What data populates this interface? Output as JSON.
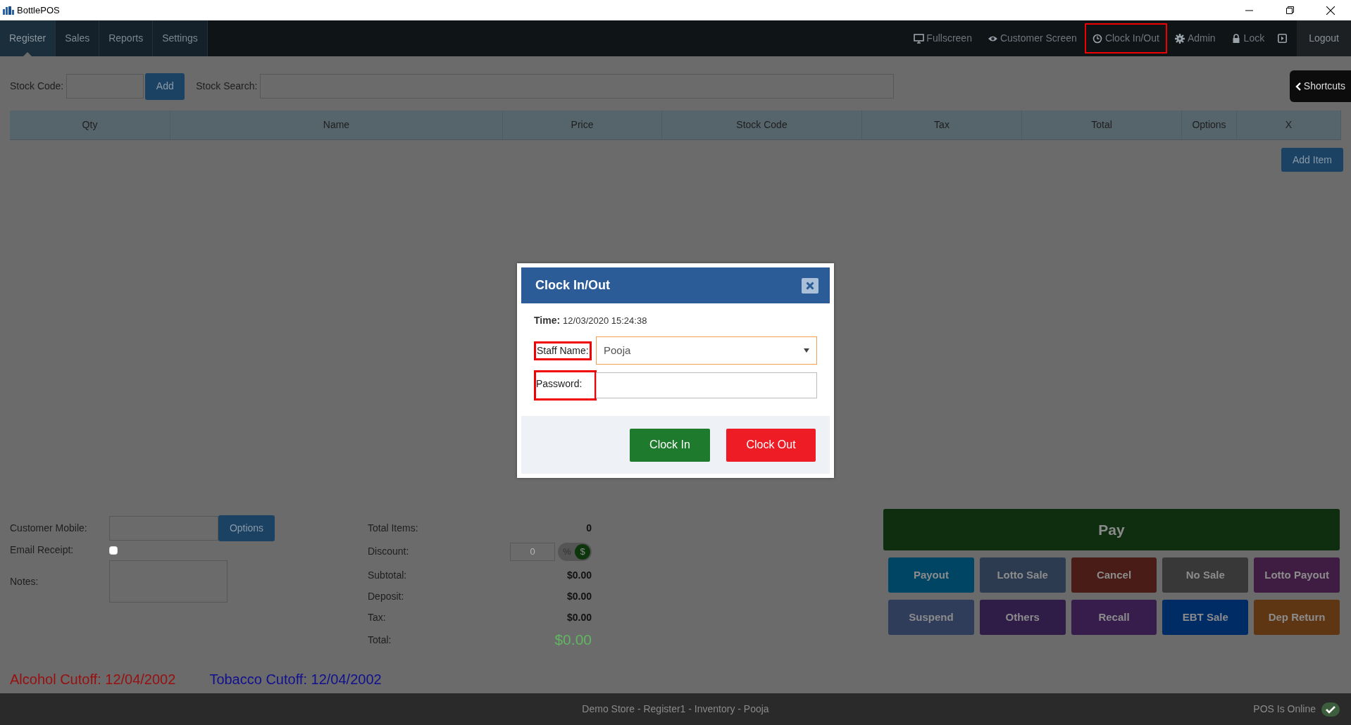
{
  "app": {
    "title": "BottlePOS"
  },
  "nav": {
    "tabs": [
      {
        "label": "Register",
        "selected": true
      },
      {
        "label": "Sales",
        "selected": false
      },
      {
        "label": "Reports",
        "selected": false
      },
      {
        "label": "Settings",
        "selected": false
      }
    ],
    "actions": [
      {
        "kind": "monitor",
        "label": "Fullscreen",
        "highlighted": false
      },
      {
        "kind": "eye",
        "label": "Customer Screen",
        "highlighted": false
      },
      {
        "kind": "clock",
        "label": "Clock In/Out",
        "highlighted": true
      },
      {
        "kind": "gear",
        "label": "Admin",
        "highlighted": false
      },
      {
        "kind": "lock",
        "label": "Lock",
        "highlighted": false
      }
    ],
    "logout": "Logout"
  },
  "stock": {
    "code_label": "Stock Code:",
    "add_button": "Add",
    "search_label": "Stock Search:",
    "shortcuts": "Shortcuts"
  },
  "table": {
    "columns": [
      "Qty",
      "Name",
      "Price",
      "Stock Code",
      "Tax",
      "Total",
      "Options",
      "X"
    ],
    "add_item": "Add Item"
  },
  "customer": {
    "mobile_label": "Customer Mobile:",
    "options_button": "Options",
    "email_label": "Email Receipt:",
    "email_checked": false,
    "notes_label": "Notes:"
  },
  "totals": [
    {
      "kind": "plain",
      "label": "Total Items:",
      "value": "0"
    },
    {
      "kind": "discount",
      "label": "Discount:",
      "placeholder": "0",
      "toggle": [
        {
          "label": "%",
          "selected": false
        },
        {
          "label": "$",
          "selected": true
        }
      ]
    },
    {
      "kind": "plain",
      "label": "Subtotal:",
      "value": "$0.00"
    },
    {
      "kind": "plain",
      "label": "Deposit:",
      "value": "$0.00"
    },
    {
      "kind": "plain",
      "label": "Tax:",
      "value": "$0.00"
    },
    {
      "kind": "total",
      "label": "Total:",
      "value": "$0.00"
    }
  ],
  "pay": {
    "label": "Pay",
    "buttons": [
      {
        "label": "Payout",
        "color": "#004563"
      },
      {
        "label": "Lotto Sale",
        "color": "#2d3b50"
      },
      {
        "label": "Cancel",
        "color": "#4a1c17"
      },
      {
        "label": "No Sale",
        "color": "#383838"
      },
      {
        "label": "Lotto Payout",
        "color": "#3f1c42"
      },
      {
        "label": "Suspend",
        "color": "#2f3c5a"
      },
      {
        "label": "Others",
        "color": "#2f1d48"
      },
      {
        "label": "Recall",
        "color": "#361d4c"
      },
      {
        "label": "EBT Sale",
        "color": "#002c66"
      },
      {
        "label": "Dep Return",
        "color": "#5e3613"
      }
    ]
  },
  "cutoffs": [
    {
      "text": "Alcohol Cutoff: 12/04/2002",
      "color": "#990f0f"
    },
    {
      "text": "Tobacco Cutoff: 12/04/2002",
      "color": "#10108f"
    }
  ],
  "status_bar": {
    "text": "Demo Store - Register1 - Inventory - Pooja",
    "online": "POS Is Online"
  },
  "modal": {
    "title": "Clock In/Out",
    "time_label": "Time:",
    "time_value": "12/03/2020 15:24:38",
    "fields": [
      {
        "kind": "select",
        "label": "Staff Name:",
        "value": "Pooja",
        "highlighted": true
      },
      {
        "kind": "password",
        "label": "Password:",
        "highlighted": true
      }
    ],
    "buttons": [
      {
        "kind": "in",
        "label": "Clock In"
      },
      {
        "kind": "out",
        "label": "Clock Out"
      }
    ]
  }
}
